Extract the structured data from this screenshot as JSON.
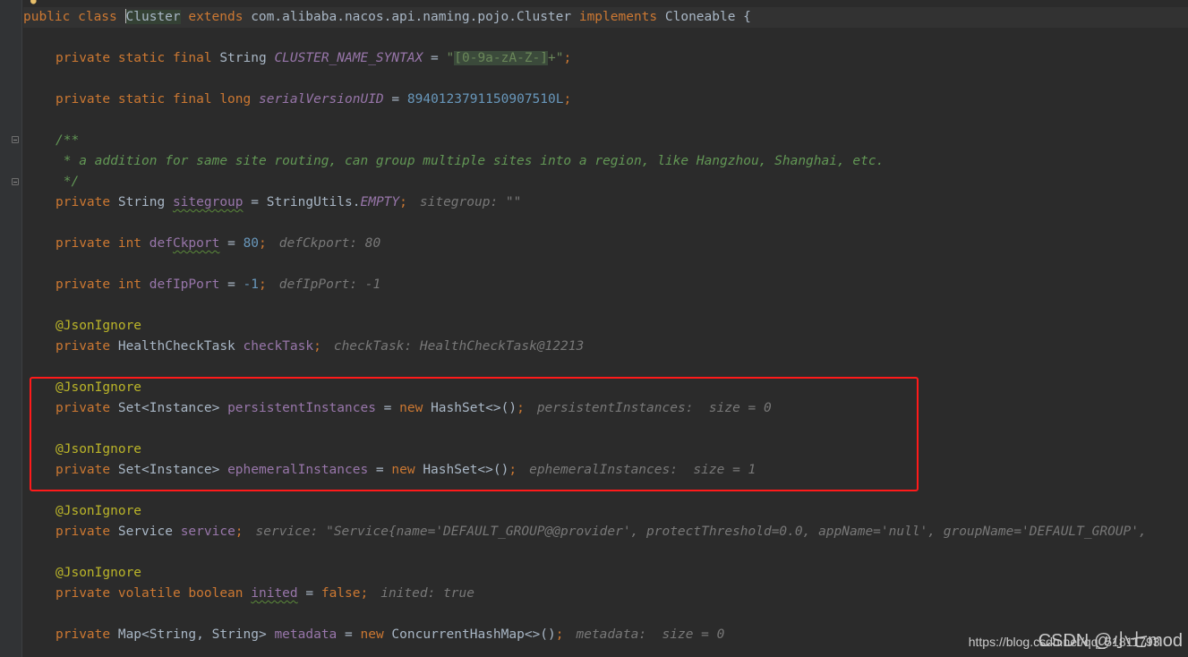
{
  "editor": {
    "lines": {
      "l1": {
        "kw1": "public class ",
        "cls": "Cluster",
        "kw2": " extends ",
        "parent": "com.alibaba.nacos.api.naming.pojo.Cluster",
        "kw3": " implements ",
        "iface": "Cloneable",
        "brace": " {"
      },
      "l2": {
        "mods": "private static final ",
        "type": "String ",
        "name": "CLUSTER_NAME_SYNTAX",
        "eq": " = ",
        "q1": "\"",
        "regex": "[0-9a-zA-Z-]",
        "rest": "+\"",
        "semi": ";"
      },
      "l3": {
        "mods": "private static final ",
        "type": "long ",
        "name": "serialVersionUID",
        "eq": " = ",
        "value": "8940123791150907510L",
        "semi": ";"
      },
      "l4": {
        "doc1": "/**",
        "doc2": " * a addition for same site routing, can group multiple sites into a region, like Hangzhou, Shanghai, etc.",
        "doc3": " */"
      },
      "l5": {
        "mods": "private ",
        "type": "String ",
        "name": "sitegroup",
        "eq": " = StringUtils.",
        "value": "EMPTY",
        "semi": ";",
        "hint": "sitegroup: \"\""
      },
      "l6": {
        "mods": "private int ",
        "name_a": "def",
        "name_b": "Ckport",
        "eq": " = ",
        "value": "80",
        "semi": ";",
        "hint": "defCkport: 80"
      },
      "l7": {
        "mods": "private int ",
        "name": "defIpPort",
        "eq": " = ",
        "value": "-1",
        "semi": ";",
        "hint": "defIpPort: -1"
      },
      "l8": {
        "ann": "@JsonIgnore",
        "mods": "private ",
        "type": "HealthCheckTask ",
        "name": "checkTask",
        "semi": ";",
        "hint": "checkTask: HealthCheckTask@12213"
      },
      "l9": {
        "ann": "@JsonIgnore",
        "mods": "private ",
        "type": "Set<Instance> ",
        "name": "persistentInstances",
        "eq": " = ",
        "kw": "new ",
        "ctor": "HashSet<>()",
        "semi": ";",
        "hint": "persistentInstances:  size = 0"
      },
      "l10": {
        "ann": "@JsonIgnore",
        "mods": "private ",
        "type": "Set<Instance> ",
        "name": "ephemeralInstances",
        "eq": " = ",
        "kw": "new ",
        "ctor": "HashSet<>()",
        "semi": ";",
        "hint": "ephemeralInstances:  size = 1"
      },
      "l11": {
        "ann": "@JsonIgnore",
        "mods": "private ",
        "type": "Service ",
        "name": "service",
        "semi": ";",
        "hint": "service: \"Service{name='DEFAULT_GROUP@@provider', protectThreshold=0.0, appName='null', groupName='DEFAULT_GROUP',"
      },
      "l12": {
        "ann": "@JsonIgnore",
        "mods": "private volatile boolean ",
        "name": "inited",
        "eq": " = ",
        "value": "false",
        "semi": ";",
        "hint": "inited: true"
      },
      "l13": {
        "mods": "private ",
        "type": "Map<String, String> ",
        "name": "metadata",
        "eq": " = ",
        "kw": "new ",
        "ctor": "ConcurrentHashMap<>()",
        "semi": ";",
        "hint": "metadata:  size = 0"
      }
    }
  },
  "watermark": {
    "url": "https://blog.csdn.net/qq_51811793",
    "brand": "CSDN @小七mod"
  },
  "colors": {
    "background": "#2b2b2b",
    "keyword": "#cc7832",
    "field": "#9876aa",
    "string": "#6a8759",
    "number": "#6897bb",
    "annotation": "#bbb529",
    "hint": "#787878",
    "highlight_box": "#ff1a1a"
  }
}
